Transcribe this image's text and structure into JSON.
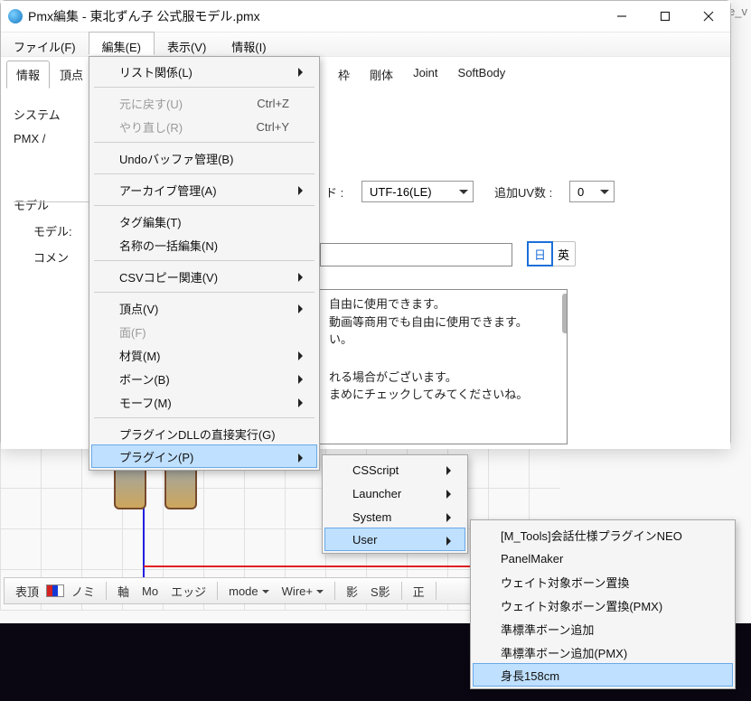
{
  "bg_right_text": "te_v",
  "window": {
    "title": "Pmx編集 - 東北ずん子 公式服モデル.pmx"
  },
  "menubar": {
    "file": "ファイル(F)",
    "edit": "編集(E)",
    "view": "表示(V)",
    "info": "情報(I)"
  },
  "tabs": {
    "t0": "情報",
    "t1": "頂点",
    "t5": "枠",
    "t6": "剛体",
    "t7": "Joint",
    "t8": "SoftBody"
  },
  "panel": {
    "system": "システム",
    "pmx": "PMX /",
    "model": "モデル",
    "modelname": "モデル:",
    "comment": "コメン",
    "enc_label": "ド :",
    "encoding": "UTF-16(LE)",
    "uv_label": "追加UV数 :",
    "uv_value": "0",
    "lang_jp": "日",
    "lang_en": "英"
  },
  "desc": {
    "l1": "自由に使用できます。",
    "l2": "動画等商用でも自由に使用できます。",
    "l3": "い。",
    "l4": "れる場合がございます。",
    "l5": "まめにチェックしてみてくださいね。"
  },
  "edit_menu": {
    "list": "リスト関係(L)",
    "undo": "元に戻す(U)",
    "undo_key": "Ctrl+Z",
    "redo": "やり直し(R)",
    "redo_key": "Ctrl+Y",
    "undobuf": "Undoバッファ管理(B)",
    "archive": "アーカイブ管理(A)",
    "tag": "タグ編集(T)",
    "rename": "名称の一括編集(N)",
    "csv": "CSVコピー関連(V)",
    "vertex": "頂点(V)",
    "face": "面(F)",
    "material": "材質(M)",
    "bone": "ボーン(B)",
    "morph": "モーフ(M)",
    "dll": "プラグインDLLの直接実行(G)",
    "plugin": "プラグイン(P)"
  },
  "plugin_menu": {
    "csscript": "CSScript",
    "launcher": "Launcher",
    "system": "System",
    "user": "User"
  },
  "user_menu": {
    "m0": "[M_Tools]会話仕様プラグインNEO",
    "m1": "PanelMaker",
    "m2": "ウェイト対象ボーン置換",
    "m3": "ウェイト対象ボーン置換(PMX)",
    "m4": "準標準ボーン追加",
    "m5": "準標準ボーン追加(PMX)",
    "m6": "身長158cm"
  },
  "toolbar": {
    "t0": "表頂",
    "t1": "ノミ",
    "t2": "軸",
    "t3": "Mo",
    "t4": "エッジ",
    "t5": "mode",
    "t6": "Wire+",
    "t7": "影",
    "t8": "S影",
    "t9": "正"
  }
}
